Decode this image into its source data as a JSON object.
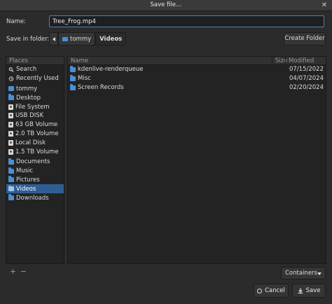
{
  "window": {
    "title": "Save file…",
    "close_glyph": "✕"
  },
  "name_field": {
    "label": "Name:",
    "value": "Tree_Frog.mp4"
  },
  "location": {
    "label": "Save in folder:",
    "breadcrumb": [
      "tommy",
      "Videos"
    ]
  },
  "toolbar": {
    "create_folder_label": "Create Folder"
  },
  "places": {
    "header": "Places",
    "items": [
      {
        "label": "Search",
        "icon": "search-icon"
      },
      {
        "label": "Recently Used",
        "icon": "clock-icon"
      },
      {
        "label": "tommy",
        "icon": "home-folder-icon"
      },
      {
        "label": "Desktop",
        "icon": "folder-icon"
      },
      {
        "label": "File System",
        "icon": "drive-icon"
      },
      {
        "label": "USB DISK",
        "icon": "drive-icon"
      },
      {
        "label": "63 GB Volume",
        "icon": "drive-icon"
      },
      {
        "label": "2.0 TB Volume",
        "icon": "drive-icon"
      },
      {
        "label": "Local Disk",
        "icon": "drive-icon"
      },
      {
        "label": "1.5 TB Volume",
        "icon": "drive-icon"
      },
      {
        "label": "Documents",
        "icon": "folder-icon"
      },
      {
        "label": "Music",
        "icon": "folder-icon"
      },
      {
        "label": "Pictures",
        "icon": "folder-icon"
      },
      {
        "label": "Videos",
        "icon": "folder-icon",
        "selected": true
      },
      {
        "label": "Downloads",
        "icon": "folder-icon"
      }
    ],
    "add_glyph": "+",
    "remove_glyph": "−"
  },
  "file_list": {
    "columns": {
      "name": "Name",
      "size": "Size",
      "modified": "Modified"
    },
    "rows": [
      {
        "name": "kdenlive-renderqueue",
        "size": "",
        "modified": "07/15/2022",
        "icon": "folder-icon"
      },
      {
        "name": "Misc",
        "size": "",
        "modified": "04/07/2024",
        "icon": "folder-icon"
      },
      {
        "name": "Screen Records",
        "size": "",
        "modified": "02/20/2024",
        "icon": "folder-icon"
      }
    ]
  },
  "filter": {
    "selected": "Containers"
  },
  "actions": {
    "cancel_label": "Cancel",
    "save_label": "Save"
  },
  "colors": {
    "accent": "#2f5e95",
    "folder": "#4a8fd6",
    "background": "#2b2b2b"
  }
}
